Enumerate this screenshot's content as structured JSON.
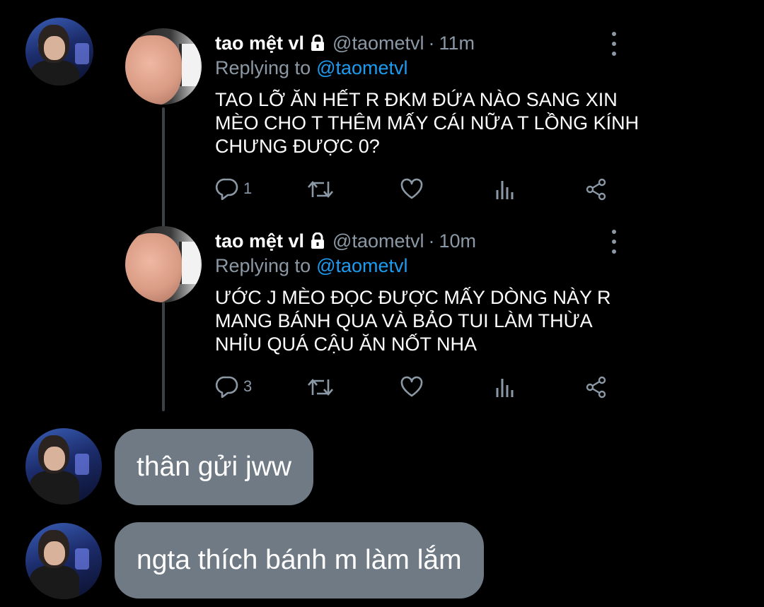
{
  "tweets": [
    {
      "name": "tao mệt vl",
      "handle": "@taometvl",
      "time": "11m",
      "replying_label": "Replying to",
      "replying_to": "@taometvl",
      "text": "TAO LỠ ĂN HẾT R ĐKM ĐỨA NÀO SANG XIN MÈO CHO T THÊM MẤY CÁI NỮA T LỒNG KÍNH CHƯNG ĐƯỢC 0?",
      "reply_count": "1"
    },
    {
      "name": "tao mệt vl",
      "handle": "@taometvl",
      "time": "10m",
      "replying_label": "Replying to",
      "replying_to": "@taometvl",
      "text": "ƯỚC J MÈO ĐỌC ĐƯỢC MẤY DÒNG NÀY R MANG BÁNH QUA VÀ BẢO TUI LÀM THỪA NHỈU QUÁ CẬU ĂN NỐT NHA",
      "reply_count": "3"
    }
  ],
  "messages": [
    {
      "text": "thân gửi jww"
    },
    {
      "text": "ngta thích bánh m làm lắm"
    }
  ],
  "icons": {
    "lock": "lock-icon",
    "more": "more-vertical-icon",
    "reply": "reply-icon",
    "retweet": "retweet-icon",
    "like": "heart-icon",
    "analytics": "analytics-icon",
    "share": "share-icon"
  },
  "colors": {
    "background": "#000000",
    "muted": "#8b98a5",
    "mention": "#1d9bf0",
    "bubble": "#6f7a85"
  }
}
